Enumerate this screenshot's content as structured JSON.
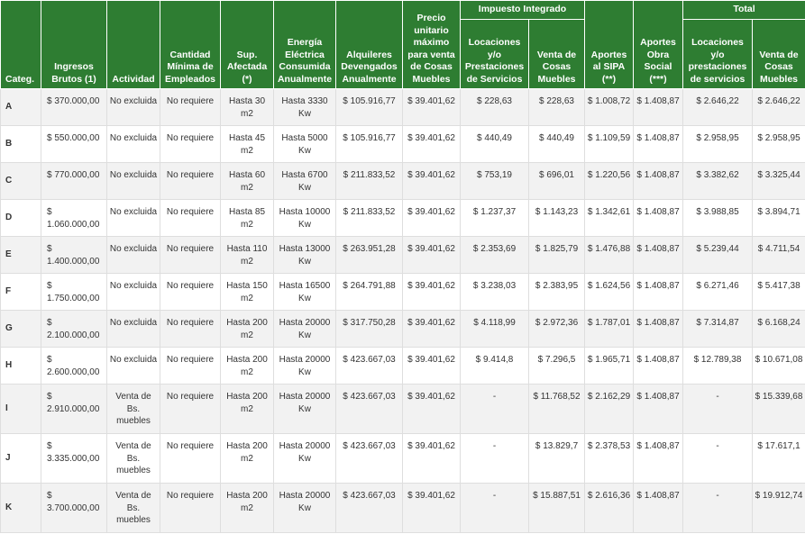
{
  "headers": {
    "categ": "Categ.",
    "ingresos": "Ingresos Brutos (1)",
    "actividad": "Actividad",
    "cantidad": "Cantidad Mínima de Empleados",
    "sup": "Sup. Afectada (*)",
    "energia": "Energía Eléctrica Consumida Anualmente",
    "alquileres": "Alquileres Devengados Anualmente",
    "precio": "Precio unitario máximo para venta de Cosas Muebles",
    "impuesto_group": "Impuesto Integrado",
    "imp_locaciones": "Locaciones y/o Prestaciones de Servicios",
    "imp_venta": "Venta de Cosas Muebles",
    "sipa": "Aportes al SIPA (**)",
    "obra": "Aportes Obra Social (***)",
    "total_group": "Total",
    "tot_locaciones": "Locaciones y/o prestaciones de servicios",
    "tot_venta": "Venta de Cosas Muebles"
  },
  "rows": [
    {
      "cat": "A",
      "ingresos": "$ 370.000,00",
      "actividad": "No excluida",
      "empleados": "No requiere",
      "sup": "Hasta 30 m2",
      "energia": "Hasta 3330 Kw",
      "alquileres": "$ 105.916,77",
      "precio": "$ 39.401,62",
      "imp_loc": "$ 228,63",
      "imp_venta": "$ 228,63",
      "sipa": "$ 1.008,72",
      "obra": "$ 1.408,87",
      "tot_loc": "$ 2.646,22",
      "tot_venta": "$ 2.646,22"
    },
    {
      "cat": "B",
      "ingresos": "$ 550.000,00",
      "actividad": "No excluida",
      "empleados": "No requiere",
      "sup": "Hasta 45 m2",
      "energia": "Hasta 5000 Kw",
      "alquileres": "$ 105.916,77",
      "precio": "$ 39.401,62",
      "imp_loc": "$ 440,49",
      "imp_venta": "$ 440,49",
      "sipa": "$ 1.109,59",
      "obra": "$ 1.408,87",
      "tot_loc": "$ 2.958,95",
      "tot_venta": "$ 2.958,95"
    },
    {
      "cat": "C",
      "ingresos": "$ 770.000,00",
      "actividad": "No excluida",
      "empleados": "No requiere",
      "sup": "Hasta 60 m2",
      "energia": "Hasta 6700 Kw",
      "alquileres": "$ 211.833,52",
      "precio": "$ 39.401,62",
      "imp_loc": "$ 753,19",
      "imp_venta": "$ 696,01",
      "sipa": "$ 1.220,56",
      "obra": "$ 1.408,87",
      "tot_loc": "$ 3.382,62",
      "tot_venta": "$ 3.325,44"
    },
    {
      "cat": "D",
      "ingresos": "$ 1.060.000,00",
      "actividad": "No excluida",
      "empleados": "No requiere",
      "sup": "Hasta 85 m2",
      "energia": "Hasta 10000 Kw",
      "alquileres": "$ 211.833,52",
      "precio": "$ 39.401,62",
      "imp_loc": "$ 1.237,37",
      "imp_venta": "$ 1.143,23",
      "sipa": "$ 1.342,61",
      "obra": "$ 1.408,87",
      "tot_loc": "$ 3.988,85",
      "tot_venta": "$ 3.894,71"
    },
    {
      "cat": "E",
      "ingresos": "$ 1.400.000,00",
      "actividad": "No excluida",
      "empleados": "No requiere",
      "sup": "Hasta 110 m2",
      "energia": "Hasta 13000 Kw",
      "alquileres": "$ 263.951,28",
      "precio": "$ 39.401,62",
      "imp_loc": "$ 2.353,69",
      "imp_venta": "$ 1.825,79",
      "sipa": "$ 1.476,88",
      "obra": "$ 1.408,87",
      "tot_loc": "$ 5.239,44",
      "tot_venta": "$ 4.711,54"
    },
    {
      "cat": "F",
      "ingresos": "$ 1.750.000,00",
      "actividad": "No excluida",
      "empleados": "No requiere",
      "sup": "Hasta 150 m2",
      "energia": "Hasta 16500 Kw",
      "alquileres": "$ 264.791,88",
      "precio": "$ 39.401,62",
      "imp_loc": "$ 3.238,03",
      "imp_venta": "$ 2.383,95",
      "sipa": "$ 1.624,56",
      "obra": "$ 1.408,87",
      "tot_loc": "$ 6.271,46",
      "tot_venta": "$ 5.417,38"
    },
    {
      "cat": "G",
      "ingresos": "$ 2.100.000,00",
      "actividad": "No excluida",
      "empleados": "No requiere",
      "sup": "Hasta 200 m2",
      "energia": "Hasta 20000 Kw",
      "alquileres": "$ 317.750,28",
      "precio": "$ 39.401,62",
      "imp_loc": "$ 4.118,99",
      "imp_venta": "$ 2.972,36",
      "sipa": "$ 1.787,01",
      "obra": "$ 1.408,87",
      "tot_loc": "$ 7.314,87",
      "tot_venta": "$ 6.168,24"
    },
    {
      "cat": "H",
      "ingresos": "$ 2.600.000,00",
      "actividad": "No excluida",
      "empleados": "No requiere",
      "sup": "Hasta 200 m2",
      "energia": "Hasta 20000 Kw",
      "alquileres": "$ 423.667,03",
      "precio": "$ 39.401,62",
      "imp_loc": "$ 9.414,8",
      "imp_venta": "$ 7.296,5",
      "sipa": "$ 1.965,71",
      "obra": "$ 1.408,87",
      "tot_loc": "$ 12.789,38",
      "tot_venta": "$ 10.671,08"
    },
    {
      "cat": "I",
      "ingresos": "$ 2.910.000,00",
      "actividad": "Venta de Bs. muebles",
      "empleados": "No requiere",
      "sup": "Hasta 200 m2",
      "energia": "Hasta 20000 Kw",
      "alquileres": "$ 423.667,03",
      "precio": "$ 39.401,62",
      "imp_loc": "-",
      "imp_venta": "$ 11.768,52",
      "sipa": "$ 2.162,29",
      "obra": "$ 1.408,87",
      "tot_loc": "-",
      "tot_venta": "$ 15.339,68"
    },
    {
      "cat": "J",
      "ingresos": "$ 3.335.000,00",
      "actividad": "Venta de Bs. muebles",
      "empleados": "No requiere",
      "sup": "Hasta 200 m2",
      "energia": "Hasta 20000 Kw",
      "alquileres": "$ 423.667,03",
      "precio": "$ 39.401,62",
      "imp_loc": "-",
      "imp_venta": "$ 13.829,7",
      "sipa": "$ 2.378,53",
      "obra": "$ 1.408,87",
      "tot_loc": "-",
      "tot_venta": "$ 17.617,1"
    },
    {
      "cat": "K",
      "ingresos": "$ 3.700.000,00",
      "actividad": "Venta de Bs. muebles",
      "empleados": "No requiere",
      "sup": "Hasta 200 m2",
      "energia": "Hasta 20000 Kw",
      "alquileres": "$ 423.667,03",
      "precio": "$ 39.401,62",
      "imp_loc": "-",
      "imp_venta": "$ 15.887,51",
      "sipa": "$ 2.616,36",
      "obra": "$ 1.408,87",
      "tot_loc": "-",
      "tot_venta": "$ 19.912,74"
    }
  ]
}
